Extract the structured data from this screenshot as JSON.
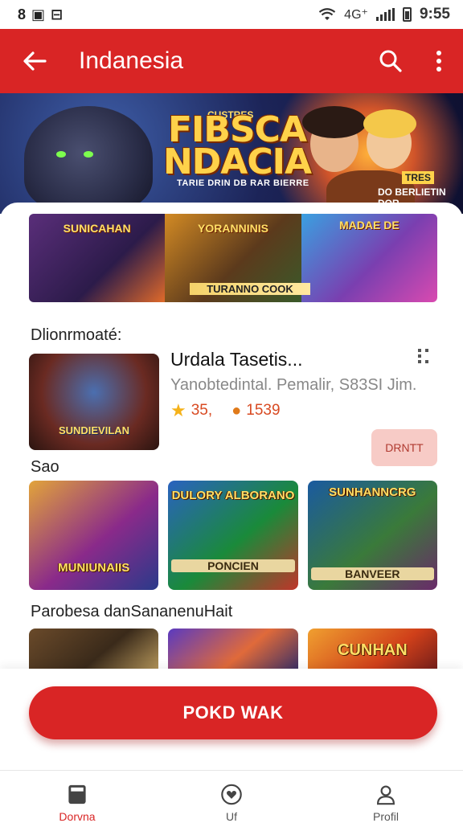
{
  "status_bar": {
    "left_icons": "8 ▣ ⊟",
    "network": "4G⁺",
    "time": "9:55"
  },
  "appbar": {
    "title": "Indanesia",
    "back_icon": "arrow-left-icon",
    "search_icon": "search-icon",
    "more_icon": "more-vertical-icon",
    "color": "#d92525"
  },
  "hero": {
    "title": "FIBSCA NDACIA",
    "kicker": "CUSTRES",
    "subtitle": "TARIE DRIN DB RAR BIERRE",
    "badge": "DO BERLIETIN DOR.",
    "tag": "TRES"
  },
  "promo_strip": {
    "panels": [
      "SUNICAHAN",
      "YORANNINIS",
      "MADAE DE"
    ],
    "caption": "TURANNO COOK"
  },
  "featured": {
    "section_title": "Dlionrmoaté:",
    "thumb_label": "SUNDIEVILAN",
    "title": "Urdala  Tasetis...",
    "description": "Yanobtedintal. Pemalir, S83SI Jim.",
    "rating": "35,",
    "downloads": "1539",
    "button_label": "DRNTT"
  },
  "section_sao": {
    "title": "Sao",
    "tiles": [
      "MUNIUNAIIS",
      "DULORY ALBORANO",
      "SUNHANNCRG"
    ],
    "tile_banners": [
      "",
      "PONCIEN",
      "BANVEER"
    ]
  },
  "section_popular": {
    "title": "Parobesa danSananenuHait",
    "tiles": [
      "",
      "",
      "CUNHAN"
    ]
  },
  "cta": {
    "label": "POKD WAK",
    "color": "#d92525"
  },
  "bottom_nav": {
    "items": [
      {
        "label": "Dorvna",
        "icon": "book-icon"
      },
      {
        "label": "Uf",
        "icon": "heart-circle-icon"
      },
      {
        "label": "Profil",
        "icon": "person-icon"
      }
    ]
  }
}
